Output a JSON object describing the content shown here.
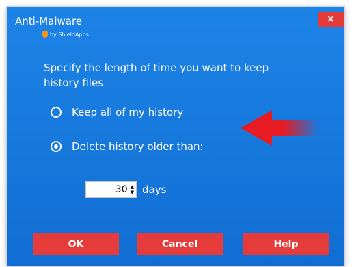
{
  "window": {
    "title": "Anti-Malware",
    "byline": "by ShieldApps",
    "close_label": "×"
  },
  "instruction": "Specify the length of time you want to keep history files",
  "options": [
    {
      "label": "Keep all of my history",
      "selected": false
    },
    {
      "label": "Delete history older than:",
      "selected": true
    }
  ],
  "retention": {
    "value": "30",
    "unit_label": "days"
  },
  "buttons": {
    "ok": "OK",
    "cancel": "Cancel",
    "help": "Help"
  },
  "colors": {
    "dialog_bg": "#1778dc",
    "button_bg": "#e53b3b",
    "annotation_arrow": "#e61b23"
  },
  "icons": [
    "shieldapps-logo-icon",
    "close-icon",
    "annotation-arrow-icon",
    "spinner-icon"
  ]
}
